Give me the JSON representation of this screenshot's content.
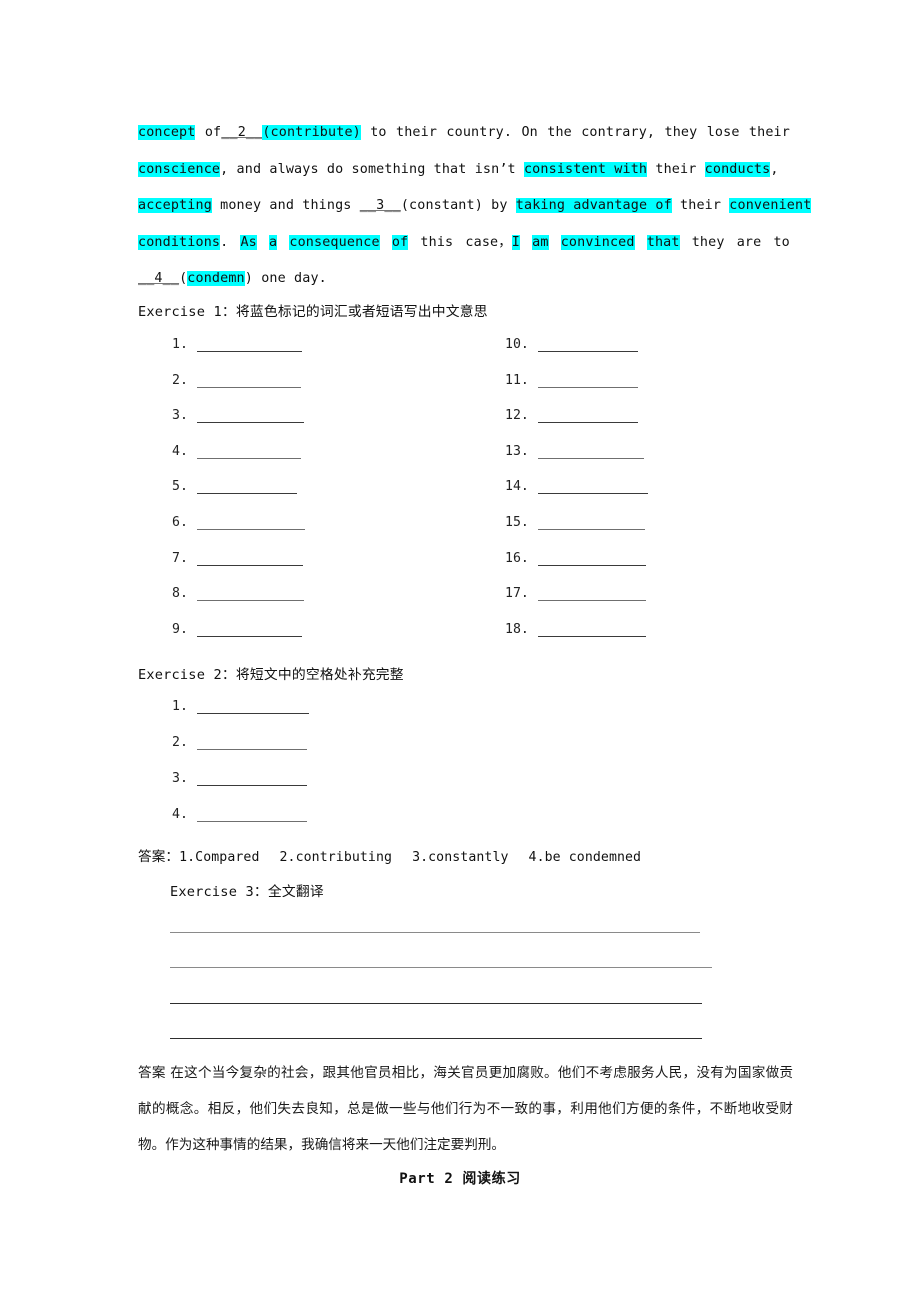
{
  "document": {
    "cloze_paragraph": {
      "lines": [
        {
          "id": "line1",
          "segments": [
            {
              "text": "concept",
              "highlight": true
            },
            {
              "text": " of",
              "highlight": false
            },
            {
              "text": "__2__",
              "highlight": false,
              "blank": true
            },
            {
              "text": "(contribute)",
              "highlight": true
            },
            {
              "text": " to their country. On the contrary, they lose their",
              "highlight": false
            }
          ]
        },
        {
          "id": "line2",
          "segments": [
            {
              "text": "conscience",
              "highlight": true
            },
            {
              "text": ", and always do something that isn’t ",
              "highlight": false
            },
            {
              "text": "consistent with",
              "highlight": true
            },
            {
              "text": " their ",
              "highlight": false
            },
            {
              "text": "conducts",
              "highlight": true
            },
            {
              "text": ",",
              "highlight": false
            }
          ]
        },
        {
          "id": "line3",
          "segments": [
            {
              "text": "accepting",
              "highlight": true
            },
            {
              "text": " money and things ",
              "highlight": false
            },
            {
              "text": "__3__",
              "highlight": false,
              "blank": true
            },
            {
              "text": "(constant) by ",
              "highlight": false
            },
            {
              "text": "taking advantage of",
              "highlight": true
            },
            {
              "text": " their ",
              "highlight": false
            },
            {
              "text": "convenient",
              "highlight": true
            }
          ]
        },
        {
          "id": "line4",
          "segments": [
            {
              "text": "conditions",
              "highlight": true
            },
            {
              "text": ". ",
              "highlight": false
            },
            {
              "text": "As a consequence of",
              "highlight": true
            },
            {
              "text": " this case，",
              "highlight": false
            },
            {
              "text": "I am convinced that",
              "highlight": true
            },
            {
              "text": " they are to",
              "highlight": false
            }
          ]
        },
        {
          "id": "line5",
          "segments": [
            {
              "text": "__4__",
              "highlight": false,
              "blank": true
            },
            {
              "text": "(",
              "highlight": false
            },
            {
              "text": "condemn",
              "highlight": true
            },
            {
              "text": ") one day.",
              "highlight": false
            }
          ]
        }
      ]
    },
    "exercise1": {
      "heading_en": "Exercise 1",
      "heading_sep": "：",
      "heading_cn": "将蓝色标记的词汇或者短语写出中文意思",
      "left_items": [
        "1.",
        "2.",
        "3.",
        "4.",
        "5.",
        "6.",
        "7.",
        "8.",
        "9."
      ],
      "right_items": [
        "10.",
        "11.",
        "12.",
        "13.",
        "14.",
        "15.",
        "16.",
        "17.",
        "18."
      ]
    },
    "exercise2": {
      "heading_en": "Exercise 2",
      "heading_sep": "：",
      "heading_cn": "将短文中的空格处补充完整",
      "items": [
        "1.",
        "2.",
        "3.",
        "4."
      ],
      "answer_label": "答案：",
      "answers": [
        "1.Compared",
        "2.contributing",
        "3.constantly",
        "4.be condemned"
      ]
    },
    "exercise3": {
      "heading_en": "Exercise 3",
      "heading_sep": "：",
      "heading_cn": "全文翻译",
      "rule_count": 4
    },
    "translation_answer": {
      "label": "答案",
      "text": " 在这个当今复杂的社会，跟其他官员相比，海关官员更加腐败。他们不考虑服务人民，没有为国家做贡献的概念。相反，他们失去良知，总是做一些与他们行为不一致的事，利用他们方便的条件，不断地收受财物。作为这种事情的结果，我确信将来一天他们注定要判刑。"
    },
    "part_heading": {
      "en": "Part 2",
      "cn": "阅读练习"
    },
    "colors": {
      "highlight": "#00FFFF",
      "text": "#111111",
      "rule": "#2e2e2e"
    }
  }
}
